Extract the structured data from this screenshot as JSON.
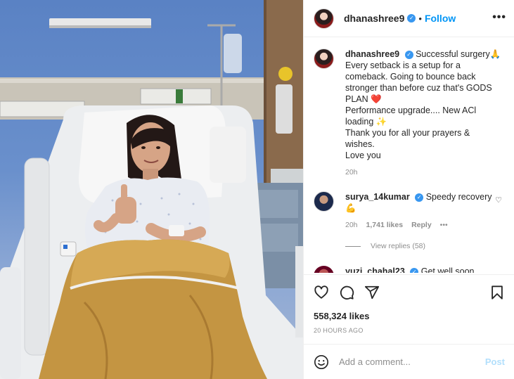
{
  "post": {
    "username": "dhanashree9",
    "follow_label": "Follow",
    "dot": "•",
    "more": "•••"
  },
  "caption": {
    "username": "dhanashree9",
    "lines": [
      "Successful surgery🙏",
      "Every setback is a setup for a",
      "comeback. Going to bounce back",
      "stronger than before cuz that's GODS",
      "PLAN ❤️",
      "Performance upgrade.... New ACl",
      "loading ✨",
      "Thank you for all your prayers &",
      "wishes.",
      "Love you"
    ],
    "time": "20h"
  },
  "comment": {
    "username": "surya_14kumar",
    "text": "Speedy recovery",
    "emoji": "💪",
    "time": "20h",
    "likes": "1,741 likes",
    "reply": "Reply",
    "more": "•••",
    "view_replies": "View replies (58)"
  },
  "next_comment": {
    "username": "yuzi_chahal23",
    "text": "Get well soon"
  },
  "actions": {
    "likes": "558,324 likes",
    "posted": "20 HOURS AGO"
  },
  "add_comment": {
    "placeholder": "Add a comment...",
    "post_label": "Post"
  },
  "colors": {
    "link_blue": "#0095f6",
    "verified_blue": "#3897f0",
    "muted": "#8e8e8e",
    "text": "#262626",
    "post_disabled": "#b2dffc"
  }
}
